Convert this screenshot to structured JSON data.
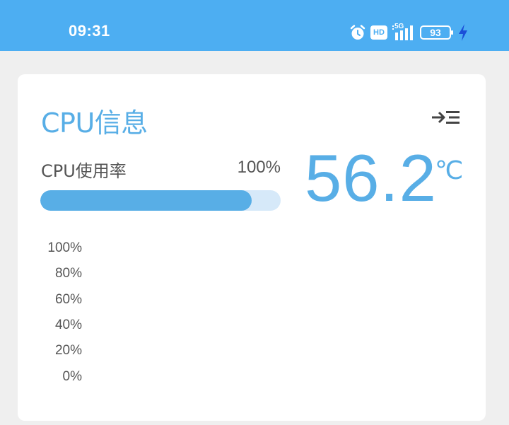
{
  "status_bar": {
    "time": "09:31",
    "network_label": "5G",
    "hd_label": "HD",
    "battery": "93",
    "icons": [
      "alarm-icon",
      "hd-icon",
      "signal-icon",
      "battery-icon",
      "charging-icon"
    ]
  },
  "card": {
    "title": "CPU信息",
    "menu_icon": "collapse-menu-icon",
    "usage_label": "CPU使用率",
    "usage_value": "100%",
    "usage_fraction": 0.88,
    "temperature": "56.2",
    "temperature_unit": "℃"
  },
  "colors": {
    "accent": "#58aee6",
    "status_bar": "#4daef2",
    "track": "#d6e9f9",
    "background": "#efefef"
  },
  "chart_data": {
    "type": "line",
    "series": [],
    "ytick_labels": [
      "100%",
      "80%",
      "60%",
      "40%",
      "20%",
      "0%"
    ],
    "ylim": [
      0,
      100
    ]
  }
}
